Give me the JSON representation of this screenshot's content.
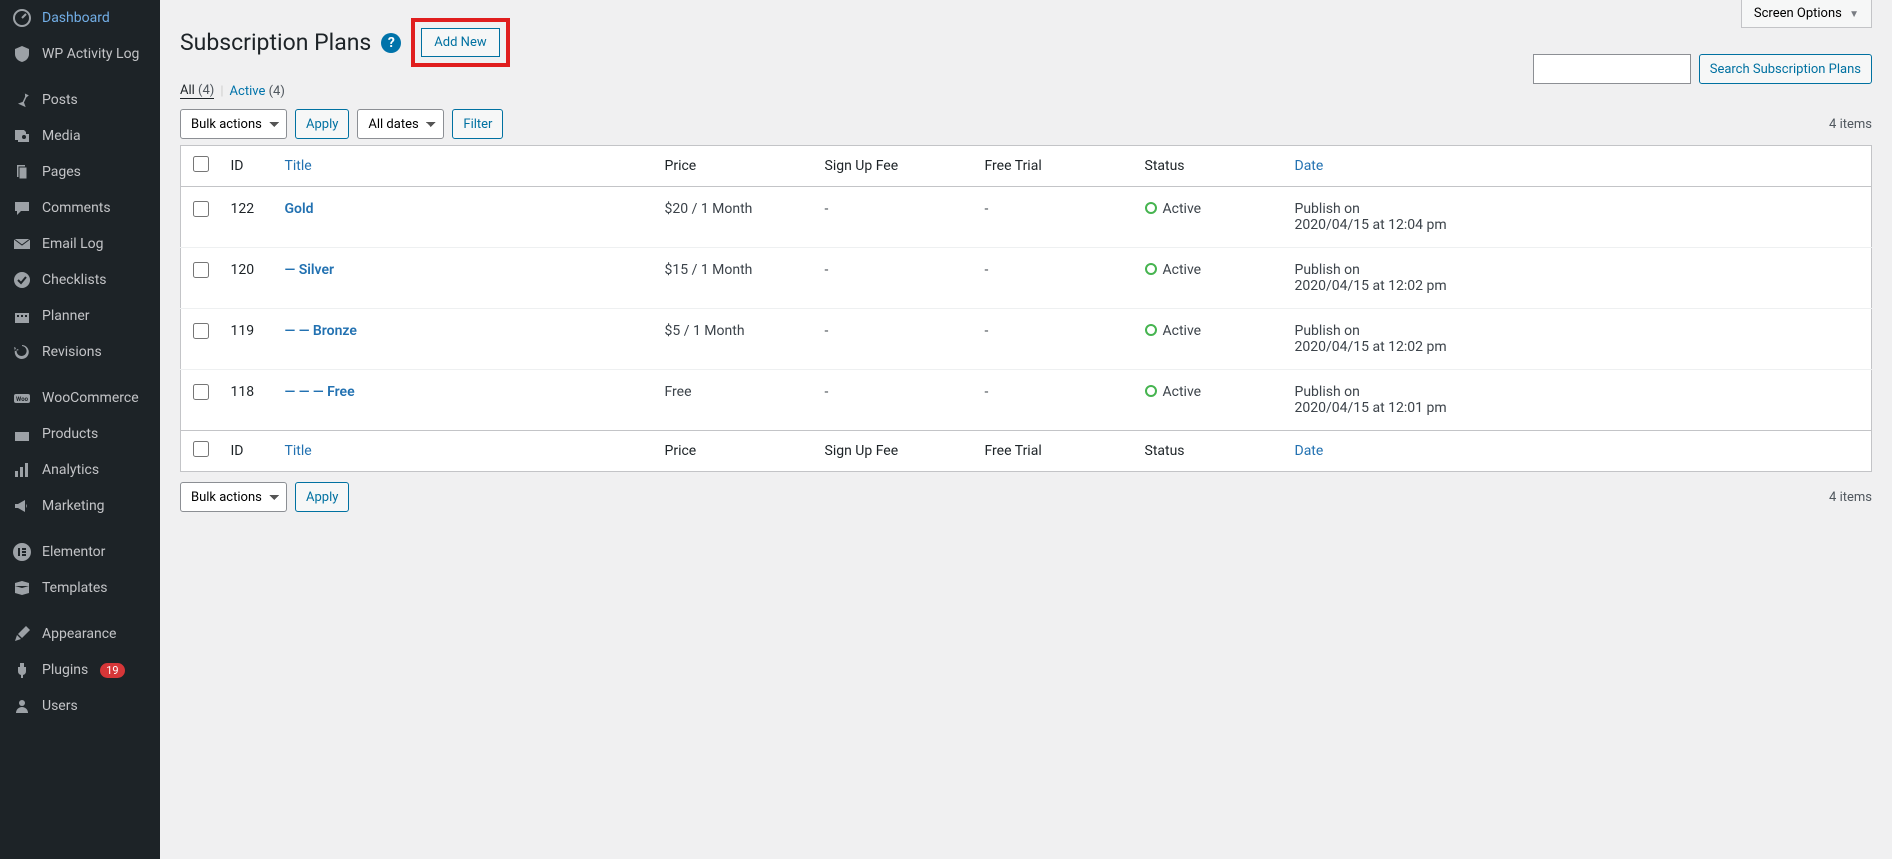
{
  "screen_options_label": "Screen Options",
  "page_title": "Subscription Plans",
  "add_new_label": "Add New",
  "filters": {
    "all_label": "All",
    "all_count": "(4)",
    "active_label": "Active",
    "active_count": "(4)"
  },
  "toolbar": {
    "bulk_label": "Bulk actions",
    "apply_label": "Apply",
    "dates_label": "All dates",
    "filter_label": "Filter",
    "search_label": "Search Subscription Plans",
    "items_count": "4 items"
  },
  "columns": {
    "id": "ID",
    "title": "Title",
    "price": "Price",
    "sign_up": "Sign Up Fee",
    "trial": "Free Trial",
    "status": "Status",
    "date": "Date"
  },
  "rows": [
    {
      "id": "122",
      "prefix": "",
      "title": "Gold",
      "price": "$20 / 1 Month",
      "signup": "-",
      "trial": "-",
      "status": "Active",
      "date1": "Publish on",
      "date2": "2020/04/15 at 12:04 pm"
    },
    {
      "id": "120",
      "prefix": "— ",
      "title": "Silver",
      "price": "$15 / 1 Month",
      "signup": "-",
      "trial": "-",
      "status": "Active",
      "date1": "Publish on",
      "date2": "2020/04/15 at 12:02 pm"
    },
    {
      "id": "119",
      "prefix": "— — ",
      "title": "Bronze",
      "price": "$5 / 1 Month",
      "signup": "-",
      "trial": "-",
      "status": "Active",
      "date1": "Publish on",
      "date2": "2020/04/15 at 12:02 pm"
    },
    {
      "id": "118",
      "prefix": "— — — ",
      "title": "Free",
      "price": "Free",
      "signup": "-",
      "trial": "-",
      "status": "Active",
      "date1": "Publish on",
      "date2": "2020/04/15 at 12:01 pm"
    }
  ],
  "sidebar": {
    "items": [
      {
        "label": "Dashboard",
        "icon": "dash"
      },
      {
        "label": "WP Activity Log",
        "icon": "shield"
      },
      {
        "label": "Posts",
        "icon": "pin",
        "sep": true
      },
      {
        "label": "Media",
        "icon": "media"
      },
      {
        "label": "Pages",
        "icon": "pages"
      },
      {
        "label": "Comments",
        "icon": "comment"
      },
      {
        "label": "Email Log",
        "icon": "mail"
      },
      {
        "label": "Checklists",
        "icon": "check"
      },
      {
        "label": "Planner",
        "icon": "cal"
      },
      {
        "label": "Revisions",
        "icon": "rev"
      },
      {
        "label": "WooCommerce",
        "icon": "woo",
        "sep": true
      },
      {
        "label": "Products",
        "icon": "prod"
      },
      {
        "label": "Analytics",
        "icon": "stats"
      },
      {
        "label": "Marketing",
        "icon": "mega"
      },
      {
        "label": "Elementor",
        "icon": "elem",
        "sep": true
      },
      {
        "label": "Templates",
        "icon": "tpl"
      },
      {
        "label": "Appearance",
        "icon": "brush",
        "sep": true
      },
      {
        "label": "Plugins",
        "icon": "plug",
        "badge": "19"
      },
      {
        "label": "Users",
        "icon": "user"
      }
    ]
  }
}
